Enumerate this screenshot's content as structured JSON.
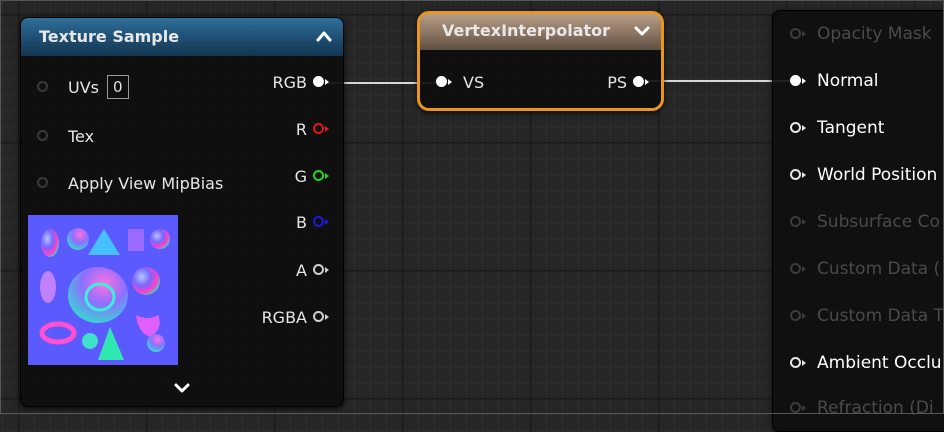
{
  "texture_node": {
    "title": "Texture Sample",
    "inputs": [
      {
        "label": "UVs",
        "value": "0"
      },
      {
        "label": "Tex"
      },
      {
        "label": "Apply View MipBias"
      }
    ],
    "outputs": [
      {
        "label": "RGB",
        "color": "#ffffff"
      },
      {
        "label": "R",
        "color": "#e01818"
      },
      {
        "label": "G",
        "color": "#22d322"
      },
      {
        "label": "B",
        "color": "#1a1ae0"
      },
      {
        "label": "A",
        "color": "#cfcfcf"
      },
      {
        "label": "RGBA",
        "color": "#cfcfcf"
      }
    ],
    "preview_icon": "normal-map-texture-thumbnail",
    "expand_icon": "chevron-down-icon",
    "collapse_icon": "chevron-up-icon"
  },
  "interpolator_node": {
    "title": "VertexInterpolator",
    "input": "VS",
    "output": "PS",
    "accent_color": "#e8961c",
    "collapse_icon": "chevron-down-icon"
  },
  "result_node": {
    "pins": [
      {
        "label": "Opacity Mask",
        "enabled": false
      },
      {
        "label": "Normal",
        "enabled": true,
        "connected": true
      },
      {
        "label": "Tangent",
        "enabled": true
      },
      {
        "label": "World Position",
        "enabled": true
      },
      {
        "label": "Subsurface Co",
        "enabled": false
      },
      {
        "label": "Custom Data (",
        "enabled": false
      },
      {
        "label": "Custom Data T",
        "enabled": false
      },
      {
        "label": "Ambient Occlu",
        "enabled": true
      },
      {
        "label": "Refraction (Di",
        "enabled": false
      }
    ]
  }
}
